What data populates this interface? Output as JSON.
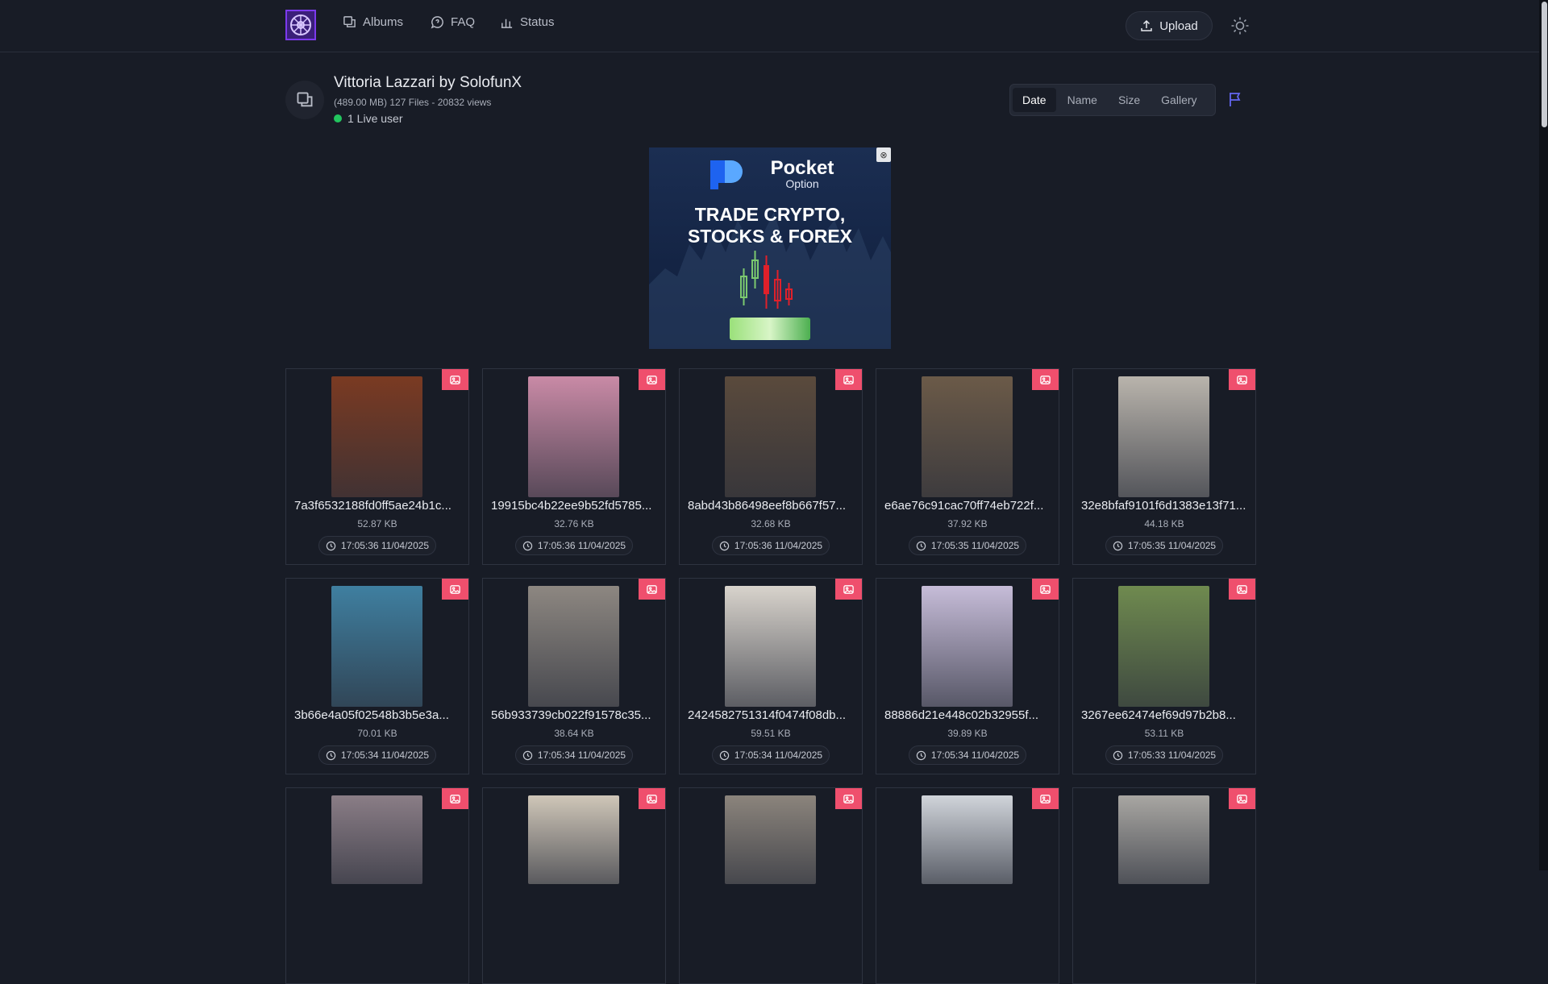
{
  "nav": {
    "albums": "Albums",
    "faq": "FAQ",
    "status": "Status",
    "upload": "Upload"
  },
  "album": {
    "title": "Vittoria Lazzari by SolofunX",
    "meta": "(489.00 MB) 127 Files - 20832 views",
    "live": "1 Live user"
  },
  "sort": {
    "date": "Date",
    "name": "Name",
    "size": "Size",
    "gallery": "Gallery",
    "active": "Date"
  },
  "ad": {
    "brand": "Pocket",
    "brand_sub": "Option",
    "headline_1": "TRADE CRYPTO,",
    "headline_2": "STOCKS & FOREX"
  },
  "colors": {
    "accent": "#7c3aed",
    "badge": "#ef4f6d",
    "live": "#22c55e"
  },
  "files": [
    {
      "name": "7a3f6532188fd0ff5ae24b1c...",
      "size": "52.87 KB",
      "date": "17:05:36 11/04/2025",
      "thumb": "#7a3a22"
    },
    {
      "name": "19915bc4b22ee9b52fd5785...",
      "size": "32.76 KB",
      "date": "17:05:36 11/04/2025",
      "thumb": "#c98aa6"
    },
    {
      "name": "8abd43b86498eef8b667f57...",
      "size": "32.68 KB",
      "date": "17:05:36 11/04/2025",
      "thumb": "#5a4a3c"
    },
    {
      "name": "e6ae76c91cac70ff74eb722f...",
      "size": "37.92 KB",
      "date": "17:05:35 11/04/2025",
      "thumb": "#6b5a48"
    },
    {
      "name": "32e8bfaf9101f6d1383e13f71...",
      "size": "44.18 KB",
      "date": "17:05:35 11/04/2025",
      "thumb": "#b9b4ac"
    },
    {
      "name": "3b66e4a05f02548b3b5e3a...",
      "size": "70.01 KB",
      "date": "17:05:34 11/04/2025",
      "thumb": "#3f7fa0"
    },
    {
      "name": "56b933739cb022f91578c35...",
      "size": "38.64 KB",
      "date": "17:05:34 11/04/2025",
      "thumb": "#8d8781"
    },
    {
      "name": "2424582751314f0474f08db...",
      "size": "59.51 KB",
      "date": "17:05:34 11/04/2025",
      "thumb": "#d8d3cc"
    },
    {
      "name": "88886d21e448c02b32955f...",
      "size": "39.89 KB",
      "date": "17:05:34 11/04/2025",
      "thumb": "#c6bcd8"
    },
    {
      "name": "3267ee62474ef69d97b2b8...",
      "size": "53.11 KB",
      "date": "17:05:33 11/04/2025",
      "thumb": "#6f8a4f"
    },
    {
      "name": "",
      "size": "",
      "date": "",
      "thumb": "#8a7d86"
    },
    {
      "name": "",
      "size": "",
      "date": "",
      "thumb": "#cfc6b8"
    },
    {
      "name": "",
      "size": "",
      "date": "",
      "thumb": "#8b847c"
    },
    {
      "name": "",
      "size": "",
      "date": "",
      "thumb": "#d0d4da"
    },
    {
      "name": "",
      "size": "",
      "date": "",
      "thumb": "#a8a6a2"
    }
  ]
}
